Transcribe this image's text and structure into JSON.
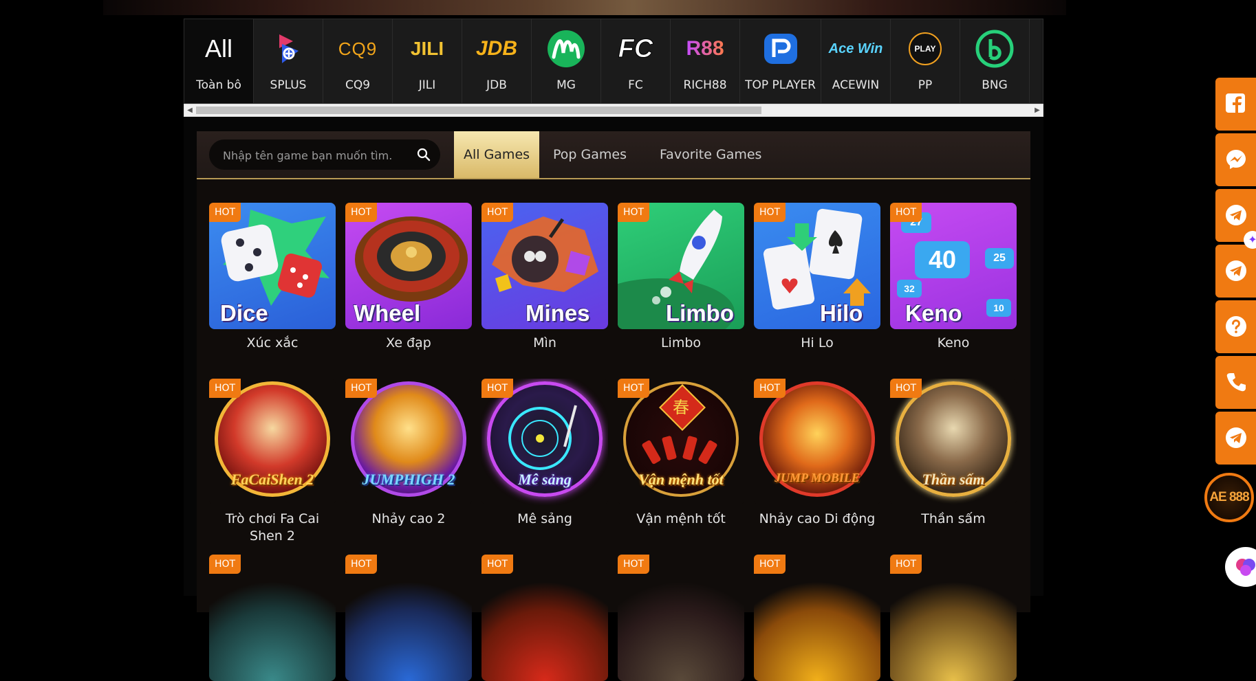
{
  "providers": [
    {
      "label": "Toàn bô",
      "logo_text": "All"
    },
    {
      "label": "SPLUS",
      "logo_text": ""
    },
    {
      "label": "CQ9",
      "logo_text": "CQ9"
    },
    {
      "label": "JILI",
      "logo_text": "JILI"
    },
    {
      "label": "JDB",
      "logo_text": "JDB"
    },
    {
      "label": "MG",
      "logo_text": ""
    },
    {
      "label": "FC",
      "logo_text": "FC"
    },
    {
      "label": "RICH88",
      "logo_text": "R88"
    },
    {
      "label": "TOP PLAYER",
      "logo_text": ""
    },
    {
      "label": "ACEWIN",
      "logo_text": "Ace Win"
    },
    {
      "label": "PP",
      "logo_text": "PLAY"
    },
    {
      "label": "BNG",
      "logo_text": ""
    }
  ],
  "search": {
    "placeholder": "Nhập tên game bạn muốn tìm."
  },
  "tabs": [
    "All Games",
    "Pop Games",
    "Favorite Games"
  ],
  "badge": "HOT",
  "games_row1": [
    {
      "art_text": "Dice",
      "name": "Xúc xắc"
    },
    {
      "art_text": "Wheel",
      "name": "Xe đạp"
    },
    {
      "art_text": "Mines",
      "name": "Mìn"
    },
    {
      "art_text": "Limbo",
      "name": "Limbo"
    },
    {
      "art_text": "Hilo",
      "name": "Hi Lo"
    },
    {
      "art_text": "Keno",
      "name": "Keno"
    }
  ],
  "games_row2": [
    {
      "art_text": "FaCaiShen 2",
      "name": "Trò chơi Fa Cai Shen 2"
    },
    {
      "art_text": "JUMPHIGH 2",
      "name": "Nhảy cao 2"
    },
    {
      "art_text": "Mê sảng",
      "name": "Mê sảng"
    },
    {
      "art_text": "Vận mệnh tốt",
      "name": "Vận mệnh tốt"
    },
    {
      "art_text": "JUMP MOBILE",
      "name": "Nhảy cao Di động"
    },
    {
      "art_text": "Thần sấm",
      "name": "Thần sấm"
    }
  ],
  "keno_numbers": [
    "40",
    "27",
    "25",
    "32",
    "10"
  ],
  "dice_art_symbol": "春",
  "floating_logo": "AE 888",
  "colors": {
    "accent": "#f07a12",
    "gold": "#d9b968",
    "panel": "#100c0a"
  }
}
